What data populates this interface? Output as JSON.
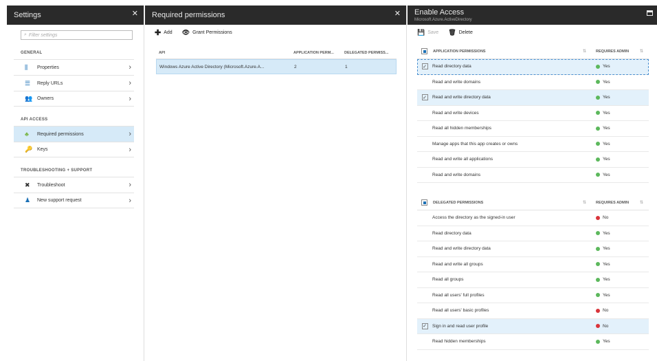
{
  "settings": {
    "title": "Settings",
    "close": "✕",
    "search_placeholder": "Filter settings",
    "sections": [
      {
        "heading": "GENERAL",
        "items": [
          {
            "label": "Properties",
            "icon": "properties-icon",
            "glyph": "⫼",
            "color": "#1a6fb5"
          },
          {
            "label": "Reply URLs",
            "icon": "reply-urls-icon",
            "glyph": "☰",
            "color": "#1a6fb5"
          },
          {
            "label": "Owners",
            "icon": "owners-icon",
            "glyph": "👥",
            "color": "#1a6fb5"
          }
        ]
      },
      {
        "heading": "API ACCESS",
        "items": [
          {
            "label": "Required permissions",
            "icon": "required-permissions-icon",
            "glyph": "♣",
            "color": "#7ab648",
            "active": true
          },
          {
            "label": "Keys",
            "icon": "key-icon",
            "glyph": "🔑",
            "color": "#e8b800"
          }
        ]
      },
      {
        "heading": "TROUBLESHOOTING + SUPPORT",
        "items": [
          {
            "label": "Troubleshoot",
            "icon": "troubleshoot-icon",
            "glyph": "✖",
            "color": "#333"
          },
          {
            "label": "New support request",
            "icon": "support-request-icon",
            "glyph": "♟",
            "color": "#1a6fb5"
          }
        ]
      }
    ]
  },
  "required": {
    "title": "Required permissions",
    "close": "✕",
    "add_label": "Add",
    "grant_label": "Grant Permissions",
    "columns": [
      "API",
      "APPLICATION PERM...",
      "DELEGATED PERMISS..."
    ],
    "rows": [
      {
        "api": "Windows Azure Active Directory (Microsoft.Azure.A...",
        "app": "2",
        "delegated": "1"
      }
    ]
  },
  "enable": {
    "title": "Enable Access",
    "subtitle": "Microsoft.Azure.ActiveDirectory",
    "save_label": "Save",
    "delete_label": "Delete",
    "app_heading": "APPLICATION PERMISSIONS",
    "admin_heading": "REQUIRES ADMIN",
    "app_perms": [
      {
        "name": "Read directory data",
        "checked": true,
        "admin": "Yes"
      },
      {
        "name": "Read and write domains",
        "checked": false,
        "admin": "Yes"
      },
      {
        "name": "Read and write directory data",
        "checked": true,
        "admin": "Yes"
      },
      {
        "name": "Read and write devices",
        "checked": false,
        "admin": "Yes"
      },
      {
        "name": "Read all hidden memberships",
        "checked": false,
        "admin": "Yes"
      },
      {
        "name": "Manage apps that this app creates or owns",
        "checked": false,
        "admin": "Yes"
      },
      {
        "name": "Read and write all applications",
        "checked": false,
        "admin": "Yes"
      },
      {
        "name": "Read and write domains",
        "checked": false,
        "admin": "Yes"
      }
    ],
    "del_heading": "DELEGATED PERMISSIONS",
    "del_admin_heading": "REQUIRES ADMIN",
    "del_perms": [
      {
        "name": "Access the directory as the signed-in user",
        "checked": false,
        "admin": "No"
      },
      {
        "name": "Read directory data",
        "checked": false,
        "admin": "Yes"
      },
      {
        "name": "Read and write directory data",
        "checked": false,
        "admin": "Yes"
      },
      {
        "name": "Read and write all groups",
        "checked": false,
        "admin": "Yes"
      },
      {
        "name": "Read all groups",
        "checked": false,
        "admin": "Yes"
      },
      {
        "name": "Read all users' full profiles",
        "checked": false,
        "admin": "Yes"
      },
      {
        "name": "Read all users' basic profiles",
        "checked": false,
        "admin": "No"
      },
      {
        "name": "Sign in and read user profile",
        "checked": true,
        "admin": "No"
      },
      {
        "name": "Read hidden memberships",
        "checked": false,
        "admin": "Yes"
      }
    ]
  }
}
